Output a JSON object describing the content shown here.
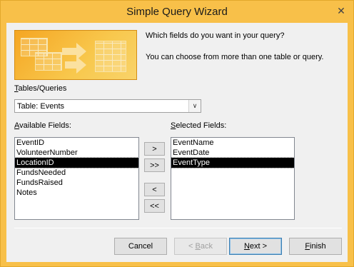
{
  "window": {
    "title": "Simple Query Wizard",
    "close_glyph": "✕"
  },
  "banner": {
    "icon": "query-wizard-illustration"
  },
  "prompt": "Which fields do you want in your query?",
  "hint": "You can choose from more than one table or query.",
  "tables": {
    "label_first": "T",
    "label_rest": "ables/Queries",
    "selected": "Table: Events",
    "dropdown_glyph": "∨"
  },
  "available": {
    "label_first": "A",
    "label_rest": "vailable Fields:",
    "items": [
      "EventID",
      "VolunteerNumber",
      "LocationID",
      "FundsNeeded",
      "FundsRaised",
      "Notes"
    ],
    "selected_index": 2
  },
  "selected_fields": {
    "label_first": "S",
    "label_rest": "elected Fields:",
    "items": [
      "EventName",
      "EventDate",
      "EventType"
    ],
    "selected_index": 2
  },
  "move_buttons": {
    "add": ">",
    "add_all": ">>",
    "remove": "<",
    "remove_all": "<<"
  },
  "footer": {
    "cancel": "Cancel",
    "back_prefix": "< ",
    "back_key": "B",
    "back_rest": "ack",
    "next_key": "N",
    "next_rest": "ext >",
    "finish_key": "F",
    "finish_rest": "inish"
  }
}
